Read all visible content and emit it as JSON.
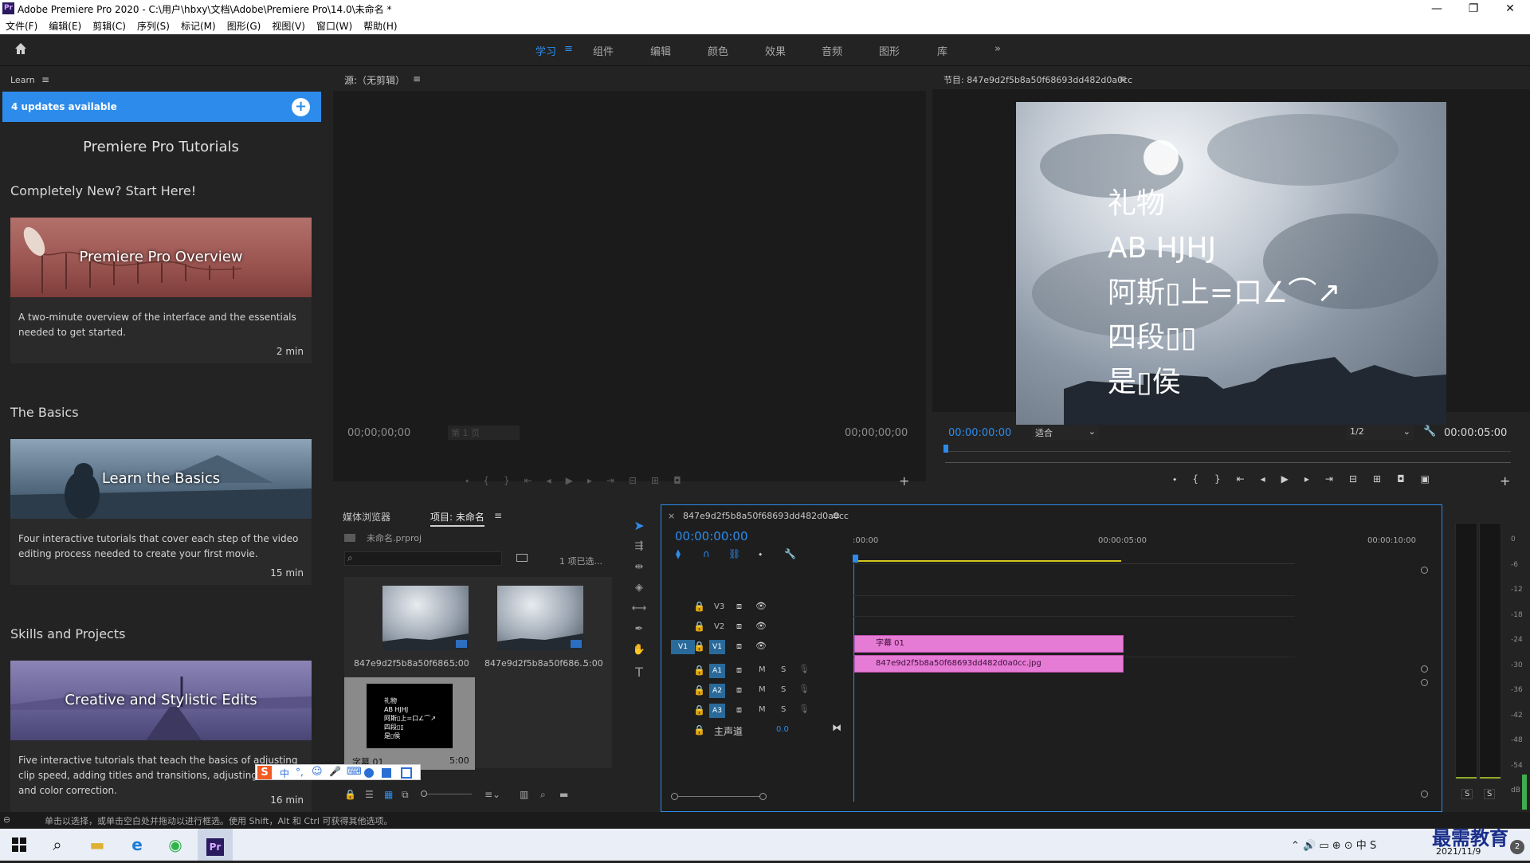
{
  "window": {
    "title": "Adobe Premiere Pro 2020 - C:\\用户\\hbxy\\文档\\Adobe\\Premiere Pro\\14.0\\未命名 *",
    "app_icon": "Pr",
    "minimize": "—",
    "maximize": "❐",
    "close": "✕"
  },
  "menu": [
    "文件(F)",
    "编辑(E)",
    "剪辑(C)",
    "序列(S)",
    "标记(M)",
    "图形(G)",
    "视图(V)",
    "窗口(W)",
    "帮助(H)"
  ],
  "workspaces": {
    "active": "学习",
    "items": [
      "组件",
      "编辑",
      "颜色",
      "效果",
      "音频",
      "图形",
      "库"
    ],
    "more": "»"
  },
  "learn": {
    "header": "Learn",
    "updates": "4 updates available",
    "title": "Premiere Pro Tutorials",
    "sections": [
      {
        "heading": "Completely New? Start Here!",
        "card_title": "Premiere Pro Overview",
        "desc": "A two-minute overview of the interface and the essentials needed to get started.",
        "duration": "2 min"
      },
      {
        "heading": "The Basics",
        "card_title": "Learn the Basics",
        "desc": "Four interactive tutorials that cover each step of the video editing process needed to create your first movie.",
        "duration": "15 min"
      },
      {
        "heading": "Skills and Projects",
        "card_title": "Creative and Stylistic Edits",
        "desc": "Five interactive tutorials that teach the basics of adjusting clip speed, adding titles and transitions, adjusting audio, and color correction.",
        "duration": "16 min"
      }
    ]
  },
  "source": {
    "header": "源:（无剪辑）",
    "tc_in": "00;00;00;00",
    "page": "第 1 页",
    "tc_out": "00;00;00;00"
  },
  "program": {
    "header": "节目: 847e9d2f5b8a50f68693dd482d0a0cc",
    "tc_current": "00:00:00:00",
    "fit": "适合",
    "res": "1/2",
    "tc_duration": "00:00:05:00",
    "overlay_lines": [
      "礼物",
      "AB HJHJ",
      "阿斯▯上=口∠⌒↗",
      "四段▯▯",
      "是▯侯"
    ]
  },
  "project": {
    "tabs": [
      "媒体浏览器",
      "项目: 未命名"
    ],
    "file": "未命名.prproj",
    "search_placeholder": "",
    "selected": "1 项已选...",
    "items": [
      {
        "name": "847e9d2f5b8a50f686...",
        "dur": "5:00"
      },
      {
        "name": "847e9d2f5b8a50f686...",
        "dur": "5:00"
      },
      {
        "name": "字幕 01",
        "dur": "5:00"
      }
    ]
  },
  "timeline": {
    "tab": "847e9d2f5b8a50f68693dd482d0a0cc",
    "tc": "00:00:00:00",
    "ruler": [
      ":00:00",
      "00:00:05:00",
      "00:00:10:00"
    ],
    "video_tracks": [
      "V3",
      "V2",
      "V1"
    ],
    "audio_tracks": [
      "A1",
      "A2",
      "A3"
    ],
    "source_patch": "V1",
    "master": "主声道",
    "master_val": "0.0",
    "clips": [
      {
        "track": "V2",
        "label": "字幕 01"
      },
      {
        "track": "V1",
        "label": "847e9d2f5b8a50f68693dd482d0a0cc.jpg"
      }
    ]
  },
  "meter": {
    "scale": [
      "0",
      "-6",
      "-12",
      "-18",
      "-24",
      "-30",
      "-36",
      "-42",
      "-48",
      "-54",
      "dB"
    ],
    "solo": [
      "S",
      "S"
    ]
  },
  "status": "单击以选择，或单击空白处并拖动以进行框选。使用 Shift，Alt 和 Ctrl 可获得其他选项。",
  "ime": [
    "中",
    "°,",
    "☺",
    "🎤",
    "⌨"
  ],
  "taskbar": {
    "date": "2021/11/9",
    "watermark": "最需教育"
  },
  "colors": {
    "accent": "#2d8ceb",
    "clip": "#e67bd6",
    "panel_bg": "#1e1e1e"
  }
}
